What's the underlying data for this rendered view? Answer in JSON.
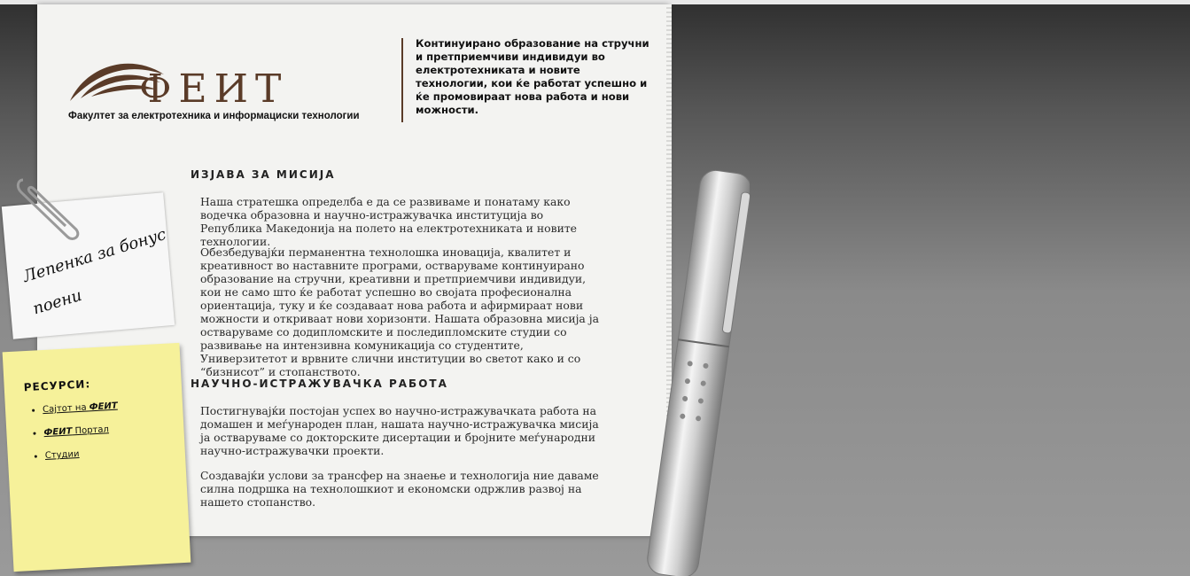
{
  "header": {
    "logo_text": "ФЕИТ",
    "logo_subtitle": "Факултет за електротехника и информациски технологии",
    "tagline": "Континуирано образование на стручни и претприемчиви индивидуи во електротехниката и новите технологии, кои ќе работат успешно и ќе промовираат нова работа и нови можности."
  },
  "mission": {
    "heading": "ИЗЈАВА ЗА МИСИЈА",
    "p1": "Наша стратешка определба е да се развиваме и понатаму како водечка образовна и научно-истражувачка институција во Република Македонија на полето на електротехниката и новите технологии.",
    "p2": "Обезбедувајќи перманентна технолошка иновација, квалитет и креативност во наставните програми, оствaруваме континуирано образование на стручни, креативни и претприемчиви индивидуи, кои не само што ќе работат успешно во својата професионална ориентација, туку и ќе создаваат нова работа и афирмираат нови можности и откриваат нови хоризонти. Нашата образовна мисија ја оствaруваме со додипломските и последипломските студии со развивање на интензивна комуникација со студентите, Универзитетот и врвните слични институции во светот како и со “бизнисот” и стопанството."
  },
  "research": {
    "heading": "НАУЧНО-ИСТРАЖУВАЧКА РАБОТА",
    "p1": "Постигнувајќи постојан успех во научно-истражувачката работа на домашен и меѓународен план, нашата научно-истражувачка мисија ја остваруваме со докторските дисертации и бројните меѓународни научно-истражувачки проекти.",
    "p2": "Создавајќи услови за трансфер на знаење и технологија ние даваме силна подршка на технолошкиот и економски одржлив развој на нашето стопанство."
  },
  "note": {
    "text": "Лепенка за бонус поени"
  },
  "resources": {
    "title": "РЕСУРСИ:",
    "links": [
      {
        "prefix": "Саjтот на ",
        "bold": "ФЕИТ",
        "suffix": ""
      },
      {
        "prefix": "",
        "bold": "ФЕИТ",
        "suffix": " Портал"
      },
      {
        "prefix": "Студии",
        "bold": "",
        "suffix": ""
      }
    ]
  },
  "colors": {
    "brand_brown": "#5a3b28",
    "sticky_yellow": "#f6f19a",
    "paper": "#f3f3f1"
  },
  "icons": {
    "paperclip": "paperclip-icon",
    "pen": "pen-icon",
    "logo_swoosh": "swoosh-logo-icon"
  }
}
